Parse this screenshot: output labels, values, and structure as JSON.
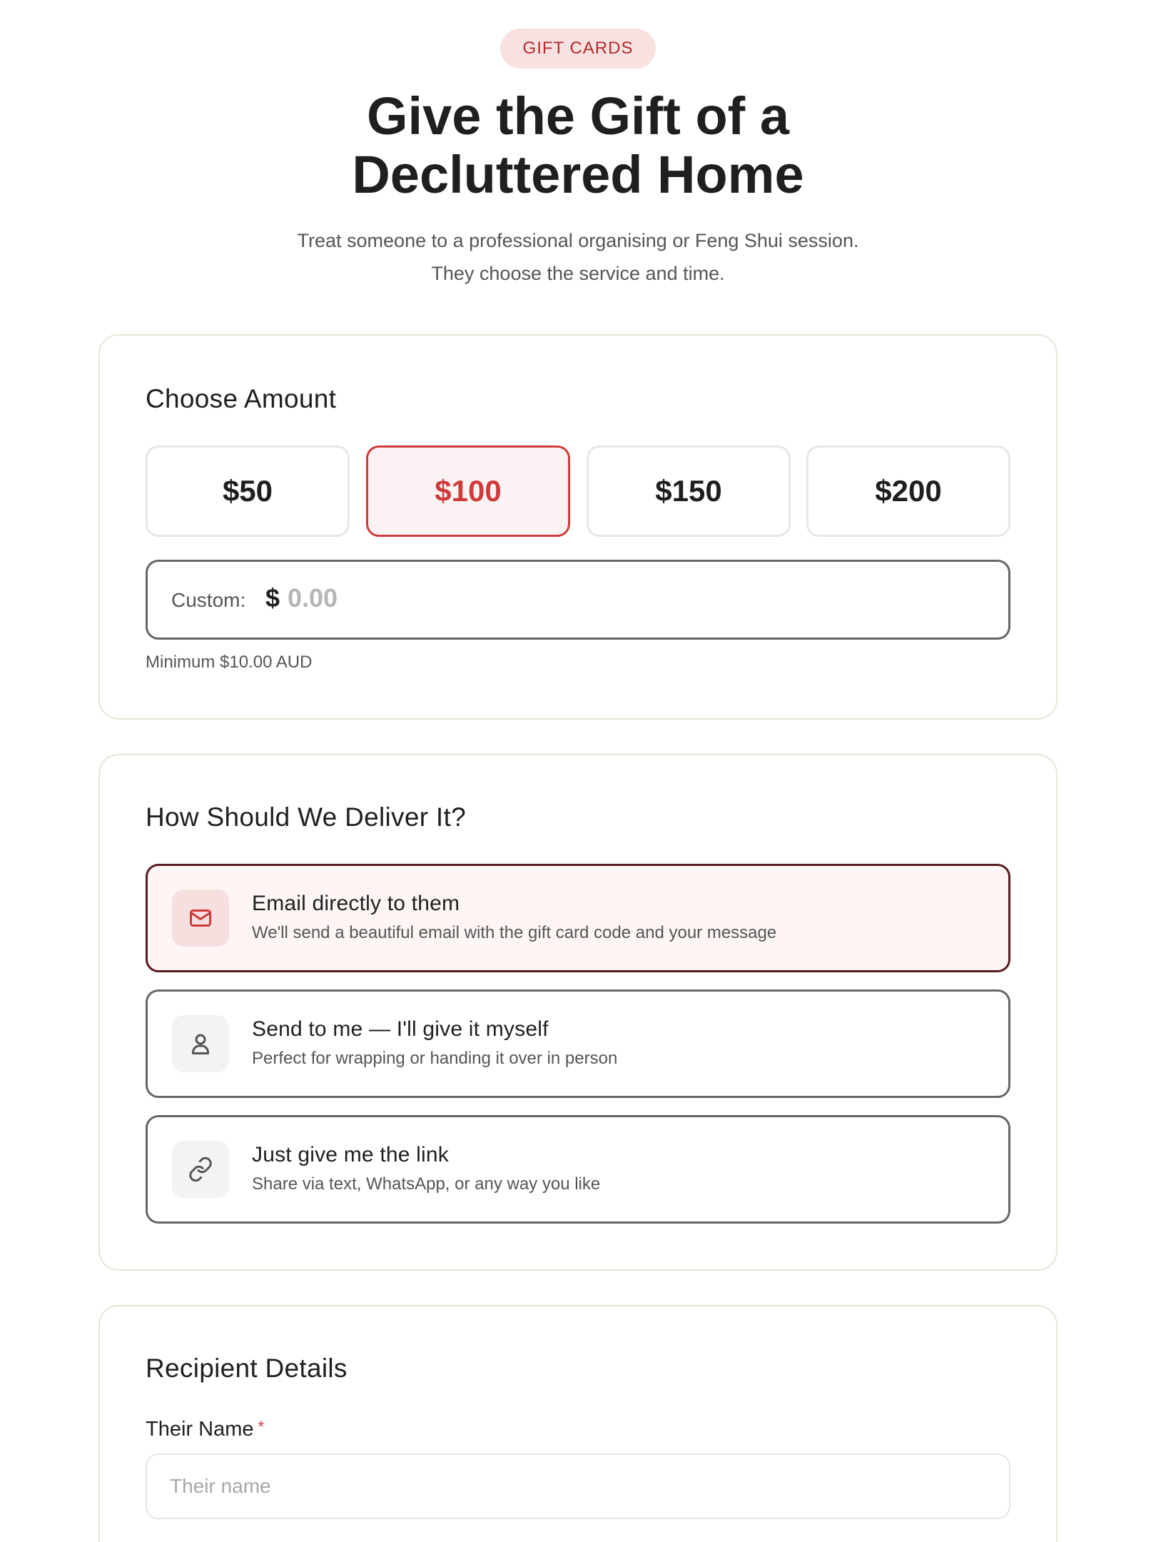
{
  "header": {
    "badge": "GIFT CARDS",
    "title_line1": "Give the Gift of a",
    "title_line2": "Decluttered Home",
    "subtitle_line1": "Treat someone to a professional organising or Feng Shui session.",
    "subtitle_line2": "They choose the service and time."
  },
  "amount": {
    "title": "Choose Amount",
    "options": [
      "$50",
      "$100",
      "$150",
      "$200"
    ],
    "selected": "$100",
    "custom_label": "Custom:",
    "currency_symbol": "$",
    "custom_placeholder": "0.00",
    "custom_value": "",
    "minimum_note": "Minimum $10.00 AUD"
  },
  "delivery": {
    "title": "How Should We Deliver It?",
    "options": [
      {
        "title": "Email directly to them",
        "description": "We'll send a beautiful email with the gift card code and your message",
        "icon": "mail-icon",
        "selected": true
      },
      {
        "title": "Send to me — I'll give it myself",
        "description": "Perfect for wrapping or handing it over in person",
        "icon": "user-icon",
        "selected": false
      },
      {
        "title": "Just give me the link",
        "description": "Share via text, WhatsApp, or any way you like",
        "icon": "link-icon",
        "selected": false
      }
    ]
  },
  "recipient": {
    "title": "Recipient Details",
    "name_label": "Their Name",
    "required_mark": "*",
    "name_placeholder": "Their name",
    "name_value": ""
  },
  "colors": {
    "accent": "#cf3b3b",
    "badge_bg": "#f9e1e1",
    "selected_border": "#5a1a1f",
    "card_border": "#e6e6d8"
  }
}
